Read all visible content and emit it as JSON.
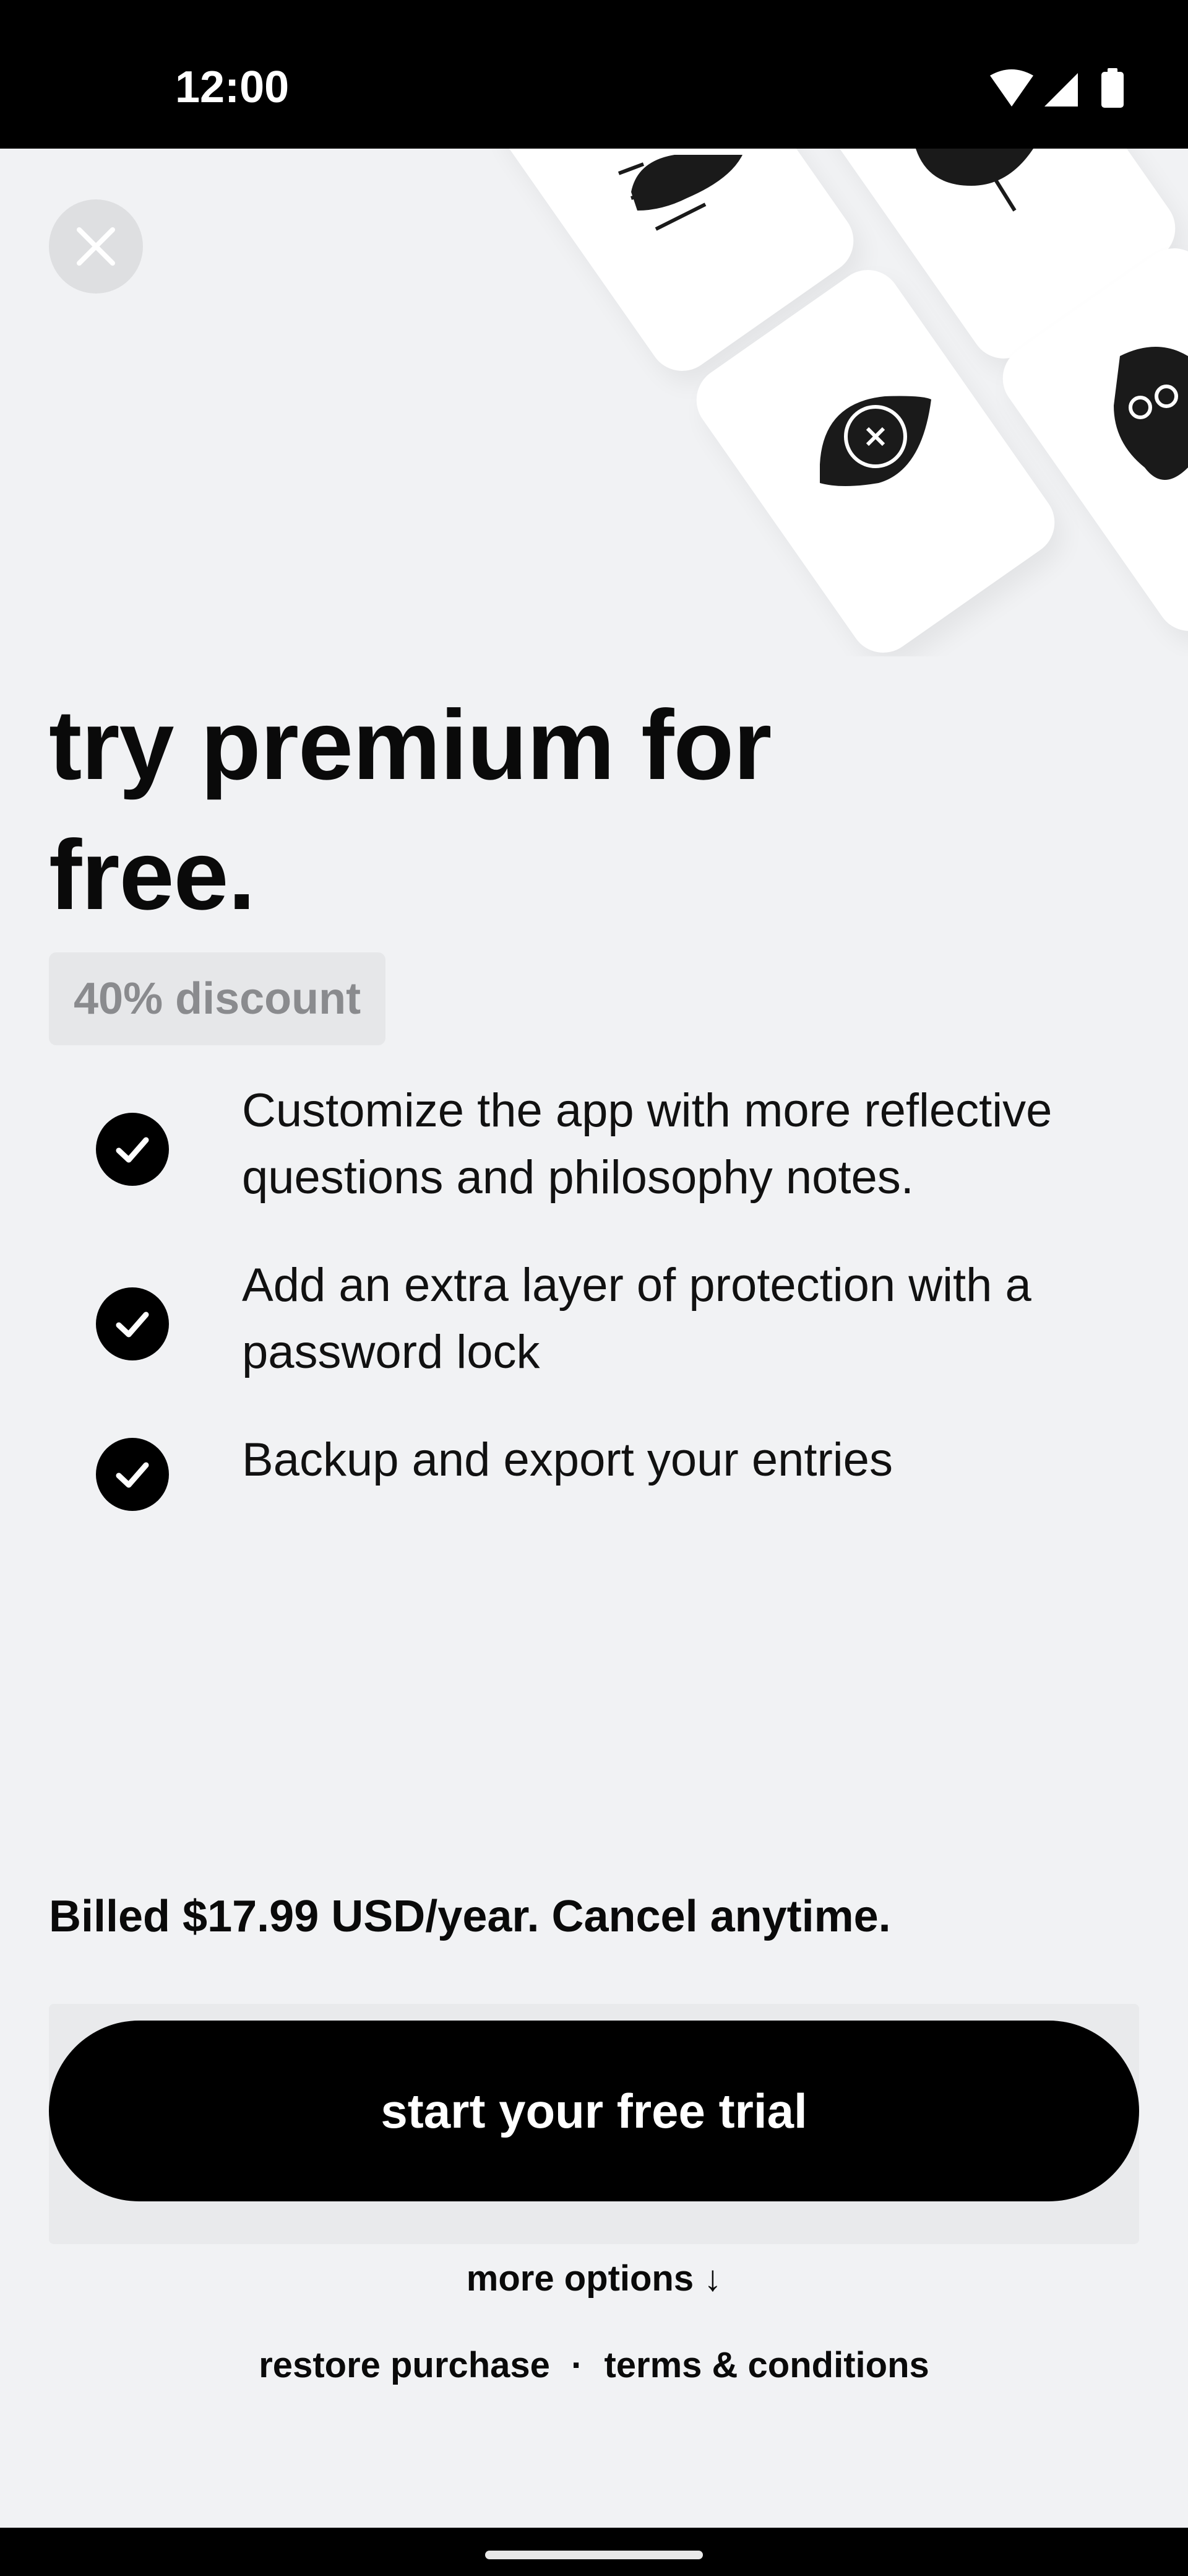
{
  "status_bar": {
    "time": "12:00",
    "icons": [
      "wifi-icon",
      "signal-icon",
      "battery-icon"
    ]
  },
  "close_icon": "close-icon",
  "headline": "try premium for free.",
  "discount_badge": "40% discount",
  "features": [
    {
      "icon": "check-icon",
      "text": "Customize the app with more reflective questions and philosophy notes."
    },
    {
      "icon": "check-icon",
      "text": "Add an extra layer of protection with a password lock"
    },
    {
      "icon": "check-icon",
      "text": "Backup and export your entries"
    }
  ],
  "billing": "Billed $17.99 USD/year. Cancel anytime.",
  "cta_label": "start your free trial",
  "more_options": "more options ↓",
  "footer": {
    "restore": "restore purchase",
    "separator": "·",
    "terms": "terms & conditions"
  },
  "colors": {
    "background": "#f1f2f4",
    "primary": "#000000",
    "badge_bg": "#e6e7e9",
    "badge_text": "#8a8b8e"
  }
}
